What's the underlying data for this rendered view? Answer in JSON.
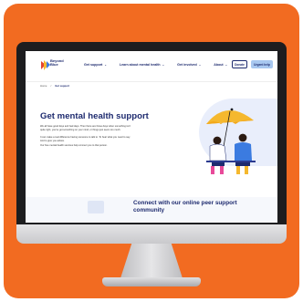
{
  "site": {
    "logo_text_line1": "Beyond",
    "logo_text_line2": "Blue",
    "nav": [
      {
        "label": "Get support"
      },
      {
        "label": "Learn about mental health"
      },
      {
        "label": "Get involved"
      },
      {
        "label": "About"
      }
    ],
    "donate_label": "Donate",
    "help_label": "Urgent help"
  },
  "breadcrumb": {
    "home": "Home",
    "separator": "/",
    "current": "Get support"
  },
  "hero": {
    "title": "Get mental health support",
    "paragraph1": "We all have good days and bad days. Then there are those days when something isn't quite right, you've got something on your mind, or things just seem too much.",
    "paragraph2": "It can make a real difference having someone to talk to. To hear what you need to say. And to give you advice.",
    "paragraph3": "Our free mental health services help connect you to that person."
  },
  "lower": {
    "title": "Connect with our online peer support community"
  },
  "colors": {
    "frame": "#f26b21",
    "brand_navy": "#1e2b6f",
    "brand_light_blue": "#a8c8f0",
    "umbrella": "#f5b82e"
  }
}
